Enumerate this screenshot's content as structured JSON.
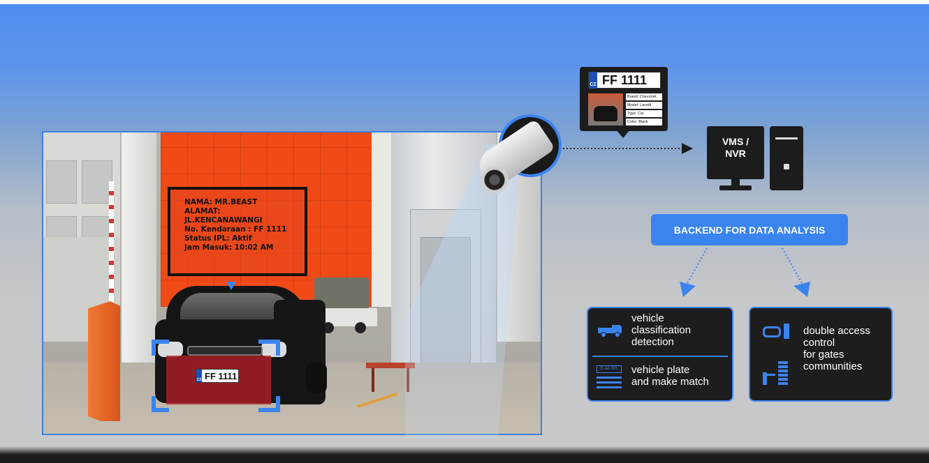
{
  "overlay": {
    "lines": [
      "NAMA: MR.BEAST",
      "ALAMAT:",
      "JL.KENCANAWANGI",
      "No. Kendaraan : FF 1111",
      "Status IPL: Aktif",
      "Jam Masuk: 10:02 AM"
    ]
  },
  "car_plate": {
    "country": "CZ",
    "number": "FF 1111"
  },
  "info_panel": {
    "plate_country": "CZ",
    "plate_number": "FF 1111",
    "specs": [
      {
        "label": "Brand:",
        "value": "Chevrolet"
      },
      {
        "label": "Model:",
        "value": "Lacetti"
      },
      {
        "label": "Type:",
        "value": "Car"
      },
      {
        "label": "Color:",
        "value": "Black"
      }
    ]
  },
  "server": {
    "label": "VMS /\nNVR"
  },
  "backend": {
    "label": "BACKEND FOR DATA ANALYSIS"
  },
  "features_left": {
    "item1": "vehicle\nclassification\ndetection",
    "item2": "vehicle plate\nand make match",
    "plate_icon_text": "E AA 001"
  },
  "features_right": {
    "item1": "double access\ncontrol\nfor gates\ncommunities"
  },
  "colors": {
    "accent": "#3a84f0",
    "barrier": "#e8682a",
    "dark": "#1d1d1d"
  }
}
